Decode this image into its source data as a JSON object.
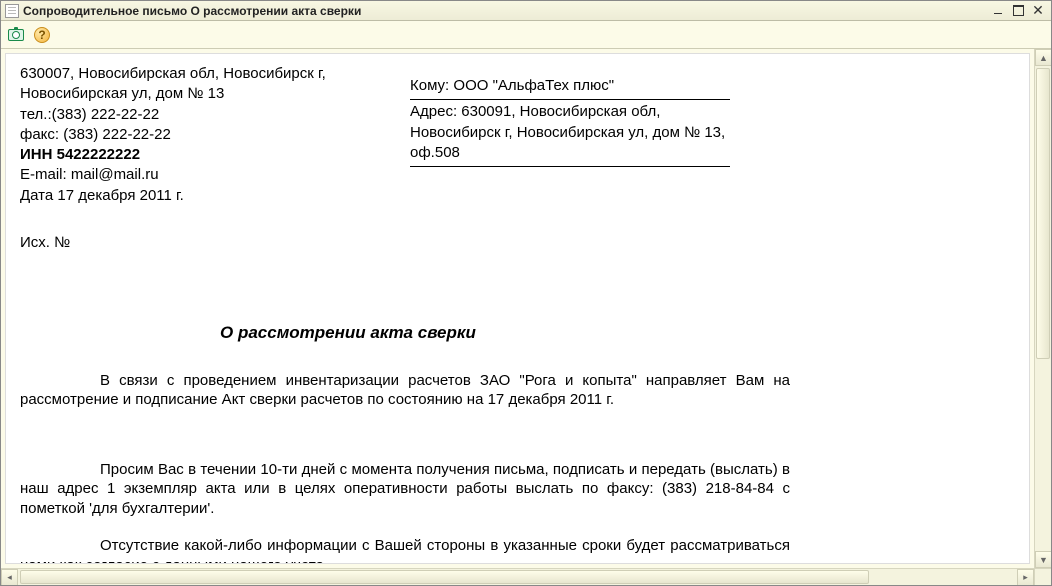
{
  "window": {
    "title": "Сопроводительное письмо О рассмотрении акта сверки"
  },
  "toolbar": {
    "help_glyph": "?"
  },
  "sender": {
    "address": "630007, Новосибирская обл, Новосибирск г, Новосибирская ул, дом № 13",
    "tel": "тел.:(383) 222-22-22",
    "fax": "факс: (383) 222-22-22",
    "inn": "ИНН 5422222222",
    "email": "E-mail: mail@mail.ru",
    "date": "Дата  17 декабря 2011 г."
  },
  "recipient": {
    "to": "Кому: ООО \"АльфаТех плюс\"",
    "address": "Адрес: 630091, Новосибирская обл, Новосибирск г, Новосибирская ул, дом № 13, оф.508"
  },
  "outgoing": "Исх. №",
  "doc_title": "О рассмотрении акта сверки",
  "body": {
    "p1": "В связи с проведением инвентаризации расчетов ЗАО \"Рога и копыта\" направляет Вам на рассмотрение и подписание Акт сверки расчетов  по состоянию на 17 декабря 2011 г.",
    "p2": "Просим Вас в течении 10-ти дней с момента получения письма, подписать и передать (выслать) в наш адрес 1 экземпляр акта или в целях оперативности работы выслать по факсу: (383) 218-84-84 с пометкой 'для бухгалтерии'.",
    "p3": "Отсутствие какой-либо информации с Вашей стороны в указанные сроки будет рассматриваться нами как согласие с данными нашего учета."
  }
}
